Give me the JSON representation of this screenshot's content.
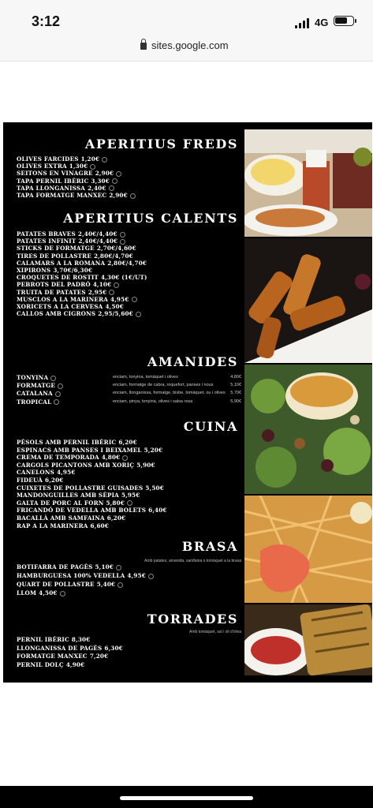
{
  "status": {
    "time": "3:12",
    "network": "4G"
  },
  "browser": {
    "url": "sites.google.com"
  },
  "sections": [
    {
      "title": "APERITIUS FREDS",
      "items": [
        {
          "name": "OLIVES FARCIDES",
          "price": "1,20€",
          "leaf": true
        },
        {
          "name": "OLIVES EXTRA",
          "price": "1,30€",
          "leaf": true
        },
        {
          "name": "SEITONS EN VINAGRE",
          "price": "2,90€",
          "leaf": true
        },
        {
          "name": "TAPA PERNIL IBÈRIC",
          "price": "3,30€",
          "leaf": true
        },
        {
          "name": "TAPA LLONGANISSA",
          "price": "2,40€",
          "leaf": true
        },
        {
          "name": "TAPA FORMATGE MANXEC",
          "price": "2,90€",
          "leaf": true
        }
      ]
    },
    {
      "title": "APERITIUS CALENTS",
      "items": [
        {
          "name": "PATATES BRAVES",
          "price": "2,40€/4,40€",
          "leaf": true
        },
        {
          "name": "PATATES INFINIT",
          "price": "2,40€/4,40€",
          "leaf": true
        },
        {
          "name": "STICKS DE FORMATGE",
          "price": "2,70€/4,60€",
          "leaf": false
        },
        {
          "name": "TIRES DE POLLASTRE",
          "price": "2,80€/4,70€",
          "leaf": false
        },
        {
          "name": "CALAMARS A LA ROMANA",
          "price": "2,80€/4,70€",
          "leaf": false
        },
        {
          "name": "XIPIRONS",
          "price": "3,70€/6,30€",
          "leaf": false
        },
        {
          "name": "CROQUETES DE ROSTIT",
          "price": "4,30€ (1€/UT)",
          "leaf": false
        },
        {
          "name": "PEBROTS DEL PADRÓ",
          "price": "4,10€",
          "leaf": true
        },
        {
          "name": "TRUITA DE PATATES",
          "price": "2,95€",
          "leaf": true
        },
        {
          "name": "MUSCLOS A LA MARINERA",
          "price": "4,95€",
          "leaf": true
        },
        {
          "name": "XORICETS A LA CERVESA",
          "price": "4,50€",
          "leaf": false
        },
        {
          "name": "CALLOS AMB CIGRONS",
          "price": "2,95/5,60€",
          "leaf": true
        }
      ]
    },
    {
      "title": "AMANIDES",
      "items": [
        {
          "name": "TONYINA",
          "desc": "enciam, tonyina, tomàquet i olives",
          "price": "4,80€",
          "leaf": true
        },
        {
          "name": "FORMATGE",
          "desc": "enciam, formatge de cabra, roquefort, panses i nous",
          "price": "5,10€",
          "leaf": true
        },
        {
          "name": "CATALANA",
          "desc": "enciam, llonganissa, formatge, bisbe, tomàquet, ou i olives",
          "price": "5,70€",
          "leaf": true
        },
        {
          "name": "TROPICAL",
          "desc": "enciam, pinya, tonyina, olives i salsa rosa",
          "price": "5,90€",
          "leaf": true
        }
      ]
    },
    {
      "title": "CUINA",
      "items": [
        {
          "name": "PÈSOLS AMB PERNIL IBÈRIC",
          "price": "6,20€",
          "leaf": false
        },
        {
          "name": "ESPINACS AMB PANSES I BEIXAMEL",
          "price": "5,20€",
          "leaf": false
        },
        {
          "name": "CREMA DE TEMPORADA",
          "price": "4,80€",
          "leaf": true
        },
        {
          "name": "CARGOLS PICANTONS AMB XORIÇ",
          "price": "5,90€",
          "leaf": false
        },
        {
          "name": "CANELONS",
          "price": "4,95€",
          "leaf": false
        },
        {
          "name": "FIDEUÀ",
          "price": "6,20€",
          "leaf": false
        },
        {
          "name": "CUIXETES DE POLLASTRE GUISADES",
          "price": "5,50€",
          "leaf": false
        },
        {
          "name": "MANDONGUILLES AMB SÈPIA",
          "price": "5,95€",
          "leaf": false
        },
        {
          "name": "GALTA DE PORC AL FORN",
          "price": "5,80€",
          "leaf": true
        },
        {
          "name": "FRICANDÓ DE VEDELLA AMB BOLETS",
          "price": "6,40€",
          "leaf": false
        },
        {
          "name": "BACALLÀ AMB SAMFAINA",
          "price": "6,20€",
          "leaf": false
        },
        {
          "name": "RAP A LA MARINERA",
          "price": "6,60€",
          "leaf": false
        }
      ]
    },
    {
      "title": "BRASA",
      "subtitle": "Amb patates, amanida, samfaina o tomàquet a la brasa",
      "items": [
        {
          "name": "BOTIFARRA DE PAGÈS",
          "price": "5,10€",
          "leaf": true
        },
        {
          "name": "HAMBURGUESA 100% VEDELLA",
          "price": "4,95€",
          "leaf": true
        },
        {
          "name": "QUART DE POLLASTRE",
          "price": "5,40€",
          "leaf": true
        },
        {
          "name": "LLOM",
          "price": "4,50€",
          "leaf": true
        }
      ]
    },
    {
      "title": "TORRADES",
      "subtitle": "Amb tomàquet, sal i oli d'oliva",
      "items": [
        {
          "name": "PERNIL IBÈRIC",
          "price": "8,30€",
          "leaf": false
        },
        {
          "name": "LLONGANISSA DE PAGÈS",
          "price": "6,30€",
          "leaf": false
        },
        {
          "name": "FORMATGE MANXEC",
          "price": "7,20€",
          "leaf": false
        },
        {
          "name": "PERNIL DOLÇ",
          "price": "4,90€",
          "leaf": false
        }
      ]
    }
  ]
}
